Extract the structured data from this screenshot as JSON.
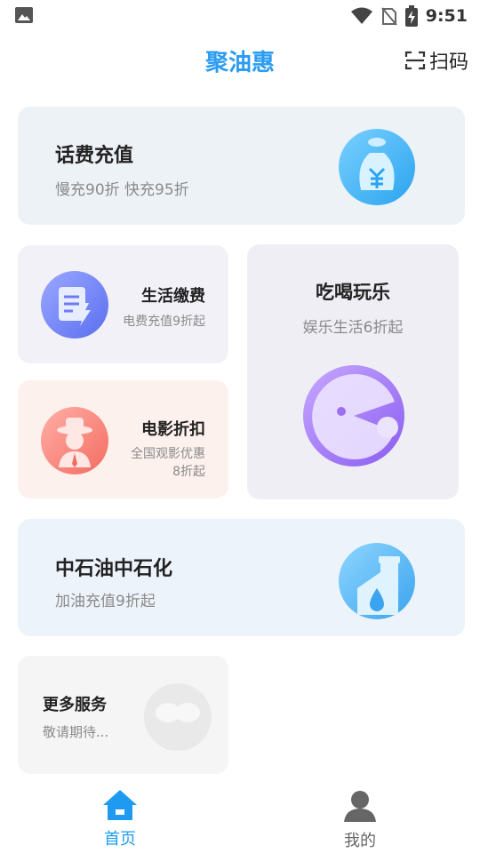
{
  "status_bar": {
    "time": "9:51",
    "icons": [
      "image-icon",
      "wifi-icon",
      "no-sim-icon",
      "battery-charging-icon"
    ]
  },
  "header": {
    "title": "聚油惠",
    "scan_label": "扫码"
  },
  "cards": {
    "phone": {
      "title": "话费充值",
      "subtitle": "慢充90折 快充95折",
      "icon": "money-bag-icon"
    },
    "life": {
      "title": "生活缴费",
      "subtitle": "电费充值9折起",
      "icon": "bill-icon"
    },
    "movie": {
      "title": "电影折扣",
      "subtitle_line1": "全国观影优惠",
      "subtitle_line2": "8折起",
      "icon": "moviegoer-icon"
    },
    "eat": {
      "title": "吃喝玩乐",
      "subtitle": "娱乐生活6折起",
      "icon": "pacman-icon"
    },
    "oil": {
      "title": "中石油中石化",
      "subtitle": "加油充值9折起",
      "icon": "oil-factory-icon"
    },
    "more": {
      "title": "更多服务",
      "subtitle": "敬请期待...",
      "icon": "more-services-icon"
    }
  },
  "tabbar": {
    "items": [
      {
        "label": "首页",
        "icon": "home-icon",
        "active": true
      },
      {
        "label": "我的",
        "icon": "user-icon",
        "active": false
      }
    ],
    "active_color": "#1e9bf0",
    "inactive_color": "#666666"
  },
  "colors": {
    "brand": "#2b9cf2"
  }
}
